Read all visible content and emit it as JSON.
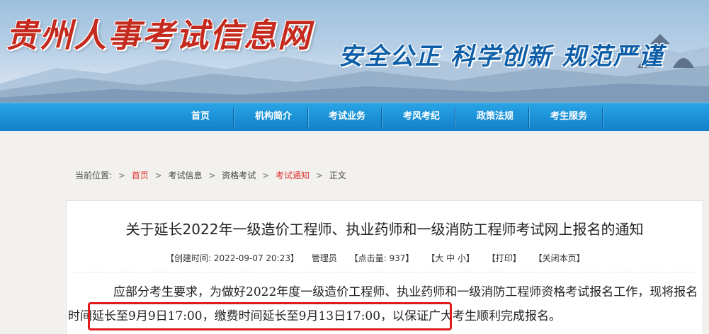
{
  "header": {
    "site_title": "贵州人事考试信息网",
    "slogan": "安全公正  科学创新  规范严谨"
  },
  "nav": {
    "items": [
      {
        "label": "首页"
      },
      {
        "label": "机构简介"
      },
      {
        "label": "考试业务"
      },
      {
        "label": "考风考纪"
      },
      {
        "label": "政策法规"
      },
      {
        "label": "考生服务"
      }
    ]
  },
  "breadcrumb": {
    "prefix": "当前位置:",
    "items": [
      "首页",
      "考试信息",
      "资格考试",
      "考试通知",
      "正文"
    ]
  },
  "article": {
    "title": "关于延长2022年一级造价工程师、执业药师和一级消防工程师考试网上报名的通知",
    "meta": {
      "created": "【创建时间:    2022-09-07 20:23】",
      "author": "管理员",
      "hits": "【点击量:  937】",
      "font_size": "【大 中 小】",
      "print": "【打印】",
      "close": "【关闭本页】"
    },
    "paragraph": "应部分考生要求，为做好2022年度一级造价工程师、执业药师和一级消防工程师资格考试报名工作，现将报名时间延长至9月9日17:00，缴费时间延长至9月13日17:00，以保证广大考生顺利完成报名。"
  },
  "colors": {
    "nav": "#1b90d6",
    "title_red": "#c52a1e",
    "slogan_blue": "#0f5fa8",
    "highlight": "#e01b1b"
  }
}
